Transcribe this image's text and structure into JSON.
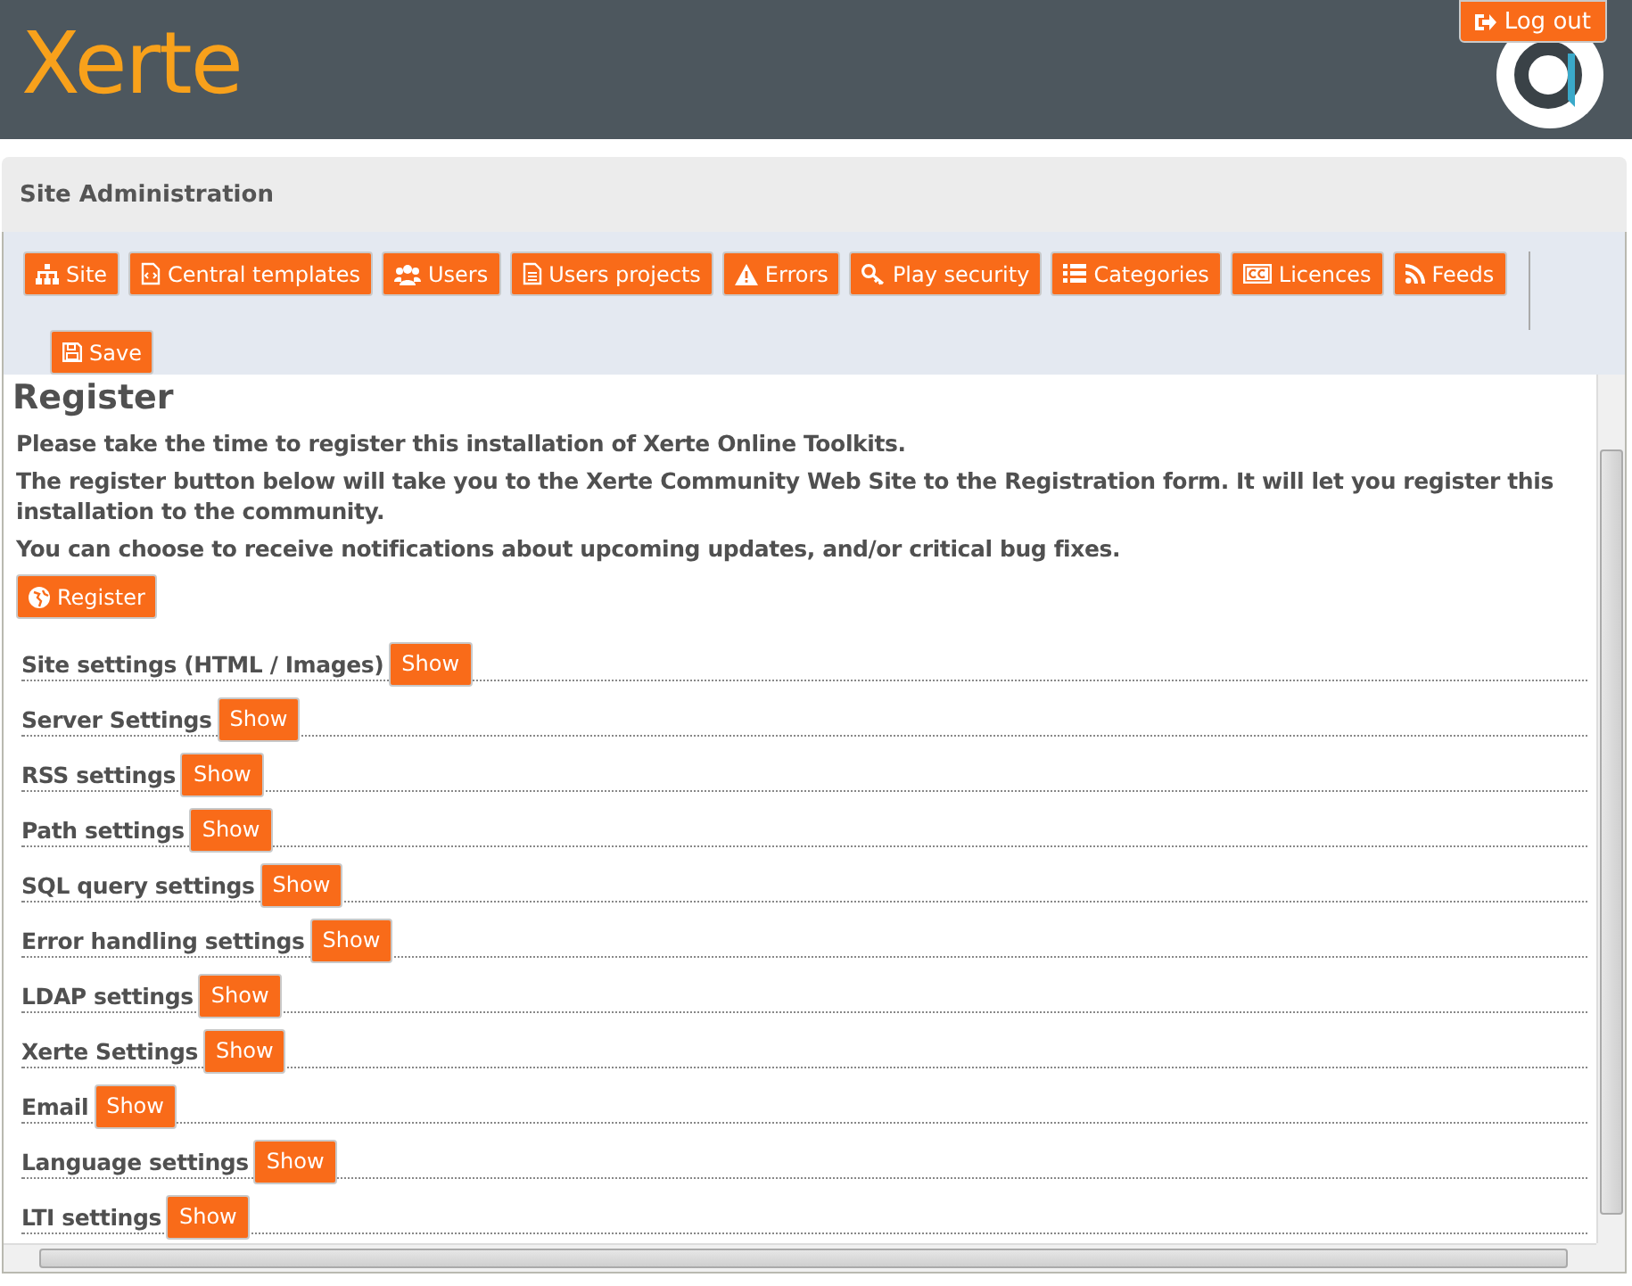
{
  "header": {
    "logo": "Xerte",
    "logout": "Log out"
  },
  "panel": {
    "title": "Site Administration",
    "tabs": [
      {
        "label": "Site"
      },
      {
        "label": "Central templates"
      },
      {
        "label": "Users"
      },
      {
        "label": "Users projects"
      },
      {
        "label": "Errors"
      },
      {
        "label": "Play security"
      },
      {
        "label": "Categories"
      },
      {
        "label": "Licences"
      },
      {
        "label": "Feeds"
      }
    ],
    "save": "Save"
  },
  "content": {
    "heading": "Register",
    "paragraphs": [
      "Please take the time to register this installation of Xerte Online Toolkits.",
      "The register button below will take you to the Xerte Community Web Site to the Registration form. It will let you register this installation to the community.",
      "You can choose to receive notifications about upcoming updates, and/or critical bug fixes."
    ],
    "register_button": "Register",
    "settings": [
      {
        "label": "Site settings (HTML / Images)",
        "button": "Show"
      },
      {
        "label": "Server Settings",
        "button": "Show"
      },
      {
        "label": "RSS settings",
        "button": "Show"
      },
      {
        "label": "Path settings",
        "button": "Show"
      },
      {
        "label": "SQL query settings",
        "button": "Show"
      },
      {
        "label": "Error handling settings",
        "button": "Show"
      },
      {
        "label": "LDAP settings",
        "button": "Show"
      },
      {
        "label": "Xerte Settings",
        "button": "Show"
      },
      {
        "label": "Email",
        "button": "Show"
      },
      {
        "label": "Language settings",
        "button": "Show"
      },
      {
        "label": "LTI settings",
        "button": "Show"
      }
    ]
  }
}
